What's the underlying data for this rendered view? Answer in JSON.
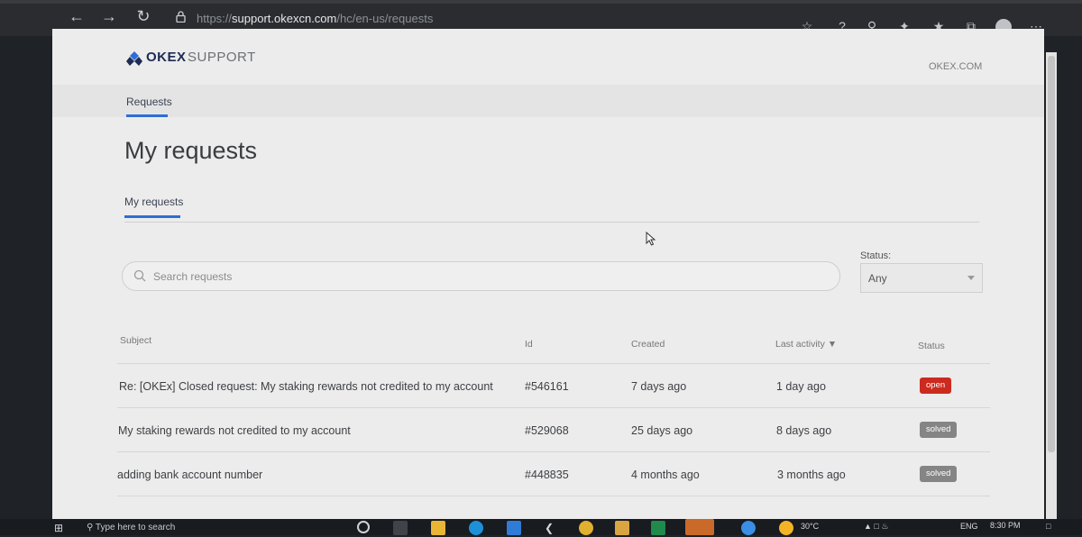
{
  "browser": {
    "url_prefix": "https://",
    "url_host": "support.okexcn.com",
    "url_path": "/hc/en-us/requests",
    "colors": {
      "bar": "#2b2c2f"
    }
  },
  "site": {
    "logo_text": "OKEX",
    "logo_sub": "SUPPORT",
    "top_link": "OKEX.COM",
    "subnav_tab": "Requests",
    "accent": "#2d6ed6"
  },
  "main": {
    "title": "My requests",
    "tab": "My requests",
    "search_placeholder": "Search requests",
    "status_label": "Status:",
    "status_value": "Any"
  },
  "table": {
    "headers": {
      "subject": "Subject",
      "id": "Id",
      "created": "Created",
      "last_activity": "Last activity ▼",
      "status": "Status"
    },
    "rows": [
      {
        "subject": "Re: [OKEx] Closed request: My staking rewards not credited to my account",
        "id": "#546161",
        "created": "7 days ago",
        "last_activity": "1 day ago",
        "status": "open"
      },
      {
        "subject": "My staking rewards not credited to my account",
        "id": "#529068",
        "created": "25 days ago",
        "last_activity": "8 days ago",
        "status": "solved"
      },
      {
        "subject": "adding bank account number",
        "id": "#448835",
        "created": "4 months ago",
        "last_activity": "3 months ago",
        "status": "solved"
      }
    ],
    "status_colors": {
      "open": "#cc2a1f",
      "solved": "#858585"
    }
  },
  "taskbar": {
    "search_text": "Type here to search",
    "weather": "30°C",
    "lang": "ENG",
    "time": "8:30 PM"
  }
}
